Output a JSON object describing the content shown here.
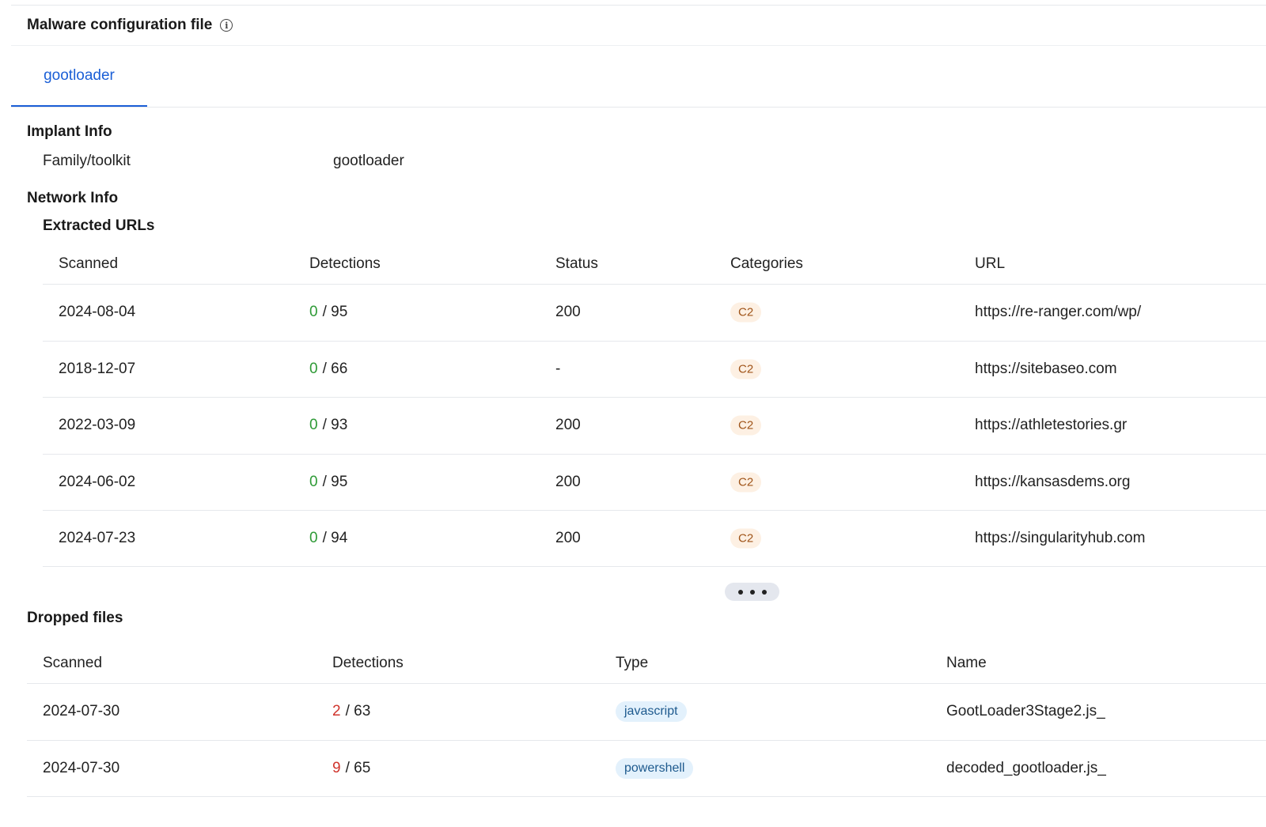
{
  "section": {
    "title": "Malware configuration file",
    "info_icon": "info-circle-icon"
  },
  "tabs": [
    {
      "label": "gootloader",
      "active": true
    }
  ],
  "implant_info": {
    "heading": "Implant Info",
    "family_label": "Family/toolkit",
    "family_value": "gootloader"
  },
  "network_info": {
    "heading": "Network Info",
    "subheading": "Extracted URLs",
    "columns": [
      "Scanned",
      "Detections",
      "Status",
      "Categories",
      "URL"
    ],
    "rows": [
      {
        "scanned": "2024-08-04",
        "det_pos": "0",
        "det_total": "/ 95",
        "status": "200",
        "category": "C2",
        "url": "https://re-ranger.com/wp/"
      },
      {
        "scanned": "2018-12-07",
        "det_pos": "0",
        "det_total": "/ 66",
        "status": "-",
        "category": "C2",
        "url": "https://sitebaseo.com"
      },
      {
        "scanned": "2022-03-09",
        "det_pos": "0",
        "det_total": "/ 93",
        "status": "200",
        "category": "C2",
        "url": "https://athletestories.gr"
      },
      {
        "scanned": "2024-06-02",
        "det_pos": "0",
        "det_total": "/ 95",
        "status": "200",
        "category": "C2",
        "url": "https://kansasdems.org"
      },
      {
        "scanned": "2024-07-23",
        "det_pos": "0",
        "det_total": "/ 94",
        "status": "200",
        "category": "C2",
        "url": "https://singularityhub.com"
      }
    ],
    "more_icon": "more-horizontal-icon"
  },
  "dropped_files": {
    "heading": "Dropped files",
    "columns": [
      "Scanned",
      "Detections",
      "Type",
      "Name"
    ],
    "rows": [
      {
        "scanned": "2024-07-30",
        "det_pos": "2",
        "det_total": "/ 63",
        "type": "javascript",
        "name": "GootLoader3Stage2.js_"
      },
      {
        "scanned": "2024-07-30",
        "det_pos": "9",
        "det_total": "/ 65",
        "type": "powershell",
        "name": "decoded_gootloader.js_"
      }
    ]
  },
  "colors": {
    "accent": "#1b5fd6",
    "detection_clean": "#2e9a36",
    "detection_malicious": "#d0342c"
  }
}
